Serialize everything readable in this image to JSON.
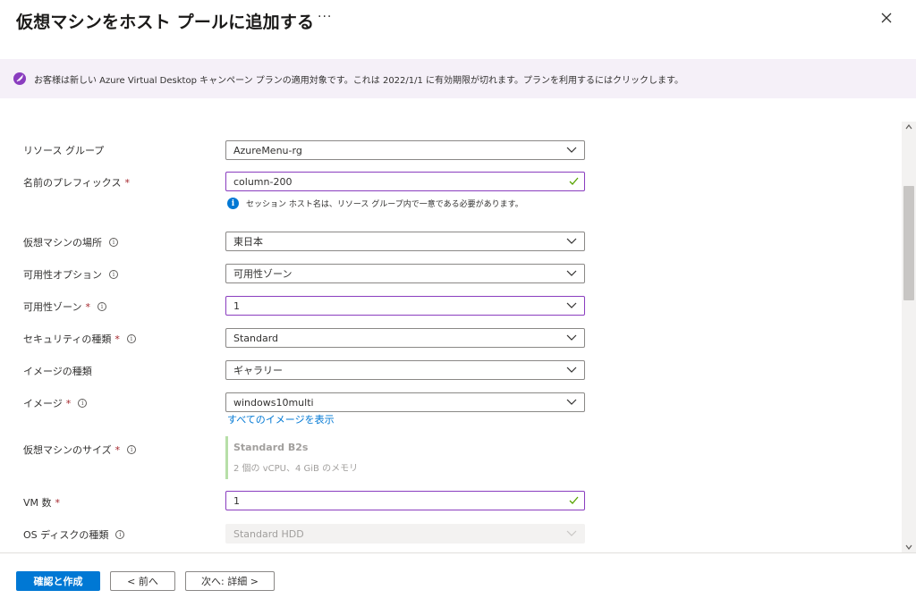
{
  "header": {
    "title": "仮想マシンをホスト プールに追加する",
    "more": "···"
  },
  "banner": {
    "text": "お客様は新しい Azure Virtual Desktop キャンペーン プランの適用対象です。これは 2022/1/1 に有効期限が切れます。プランを利用するにはクリックします。"
  },
  "form": {
    "resource_group": {
      "label": "リソース グループ",
      "value": "AzureMenu-rg"
    },
    "name_prefix": {
      "label": "名前のプレフィックス",
      "value": "column-200",
      "hint": "セッション ホスト名は、リソース グループ内で一意である必要があります。"
    },
    "vm_location": {
      "label": "仮想マシンの場所",
      "value": "東日本"
    },
    "availability_option": {
      "label": "可用性オプション",
      "value": "可用性ゾーン"
    },
    "availability_zone": {
      "label": "可用性ゾーン",
      "value": "1"
    },
    "security_type": {
      "label": "セキュリティの種類",
      "value": "Standard"
    },
    "image_type": {
      "label": "イメージの種類",
      "value": "ギャラリー"
    },
    "image": {
      "label": "イメージ",
      "value": "windows10multi",
      "link": "すべてのイメージを表示"
    },
    "vm_size": {
      "label": "仮想マシンのサイズ",
      "name": "Standard B2s",
      "desc": "2 個の vCPU、4 GiB のメモリ"
    },
    "vm_count": {
      "label": "VM 数",
      "value": "1"
    },
    "os_disk": {
      "label": "OS ディスクの種類",
      "value": "Standard HDD"
    },
    "required_mark": "*",
    "info_mark": "i"
  },
  "footer": {
    "review_create": "確認と作成",
    "prev": "< 前へ",
    "next": "次へ: 詳細 >"
  },
  "colors": {
    "primary": "#0078d4",
    "focus_border": "#8a3dbf",
    "banner_bg": "#f5f0f8",
    "valid_check": "#57a300",
    "required": "#a4262c"
  },
  "icons": [
    "more-icon",
    "close-icon",
    "rocket-icon",
    "chevron-down-icon",
    "checkmark-icon",
    "info-icon"
  ]
}
